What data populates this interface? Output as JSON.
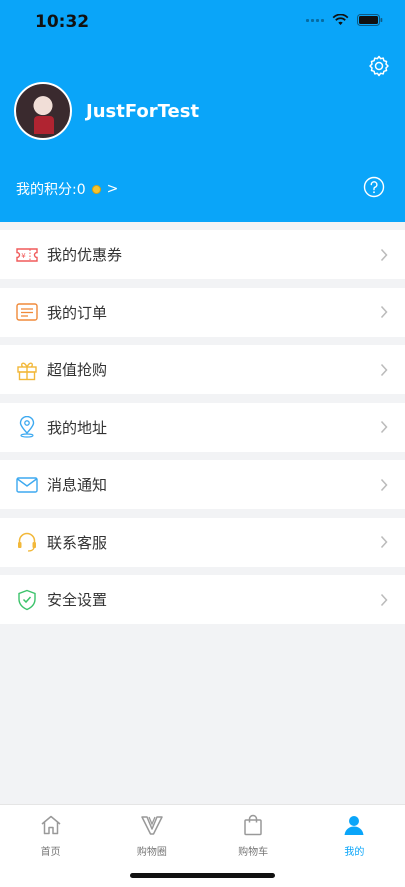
{
  "status_bar": {
    "time": "10:32"
  },
  "profile": {
    "username": "JustForTest",
    "points_label": "我的积分:0",
    "points_arrow": ">"
  },
  "menu": [
    {
      "label": "我的优惠券",
      "icon": "coupon-icon"
    },
    {
      "label": "我的订单",
      "icon": "order-icon"
    },
    {
      "label": "超值抢购",
      "icon": "gift-icon"
    },
    {
      "label": "我的地址",
      "icon": "location-icon"
    },
    {
      "label": "消息通知",
      "icon": "mail-icon"
    },
    {
      "label": "联系客服",
      "icon": "headset-icon"
    },
    {
      "label": "安全设置",
      "icon": "shield-icon"
    }
  ],
  "tabbar": [
    {
      "label": "首页",
      "icon": "home-icon",
      "active": false
    },
    {
      "label": "购物圈",
      "icon": "shopping-circle-icon",
      "active": false
    },
    {
      "label": "购物车",
      "icon": "shopping-bag-icon",
      "active": false
    },
    {
      "label": "我的",
      "icon": "user-icon",
      "active": true
    }
  ],
  "colors": {
    "primary": "#0aa5f9",
    "background": "#f2f3f5"
  }
}
